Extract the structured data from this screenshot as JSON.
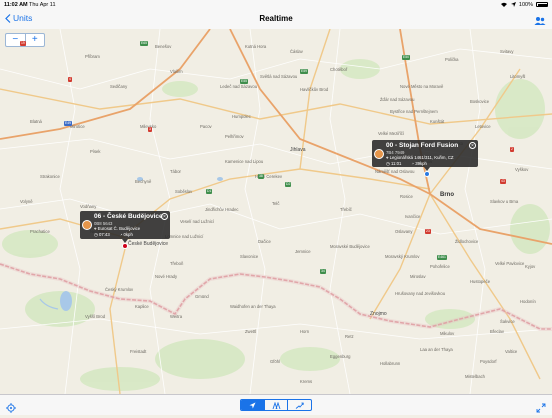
{
  "status": {
    "time": "11:02 AM",
    "date": "Thu Apr 11",
    "battery": "100%"
  },
  "nav": {
    "back_label": "Units",
    "title": "Realtime"
  },
  "map": {
    "zoom_in": "+",
    "zoom_out": "−",
    "places": {
      "brno": "Brno",
      "jihlava": "Jihlava",
      "budejovice": "České Budějovice",
      "znojmo": "Znojmo",
      "boskovice": "Boskovice",
      "blansko": "Blansko",
      "trebic": "Třebíč",
      "tabor": "Tábor",
      "pisek": "Písek",
      "pribram": "Příbram",
      "humpolec": "Humpolec",
      "havlickuv_brod": "Havlíčkův Brod",
      "zdar": "Žďár nad Sázavou",
      "velke_mezirici": "Velké Meziříčí",
      "telc": "Telč",
      "dacice": "Dačice",
      "jindrichuv_hradec": "Jindřichův Hradec",
      "trebon": "Třeboň",
      "cesky_krumlov": "Český Krumlov",
      "svitavy": "Svitavy",
      "policka": "Polička",
      "vyskov": "Vyškov",
      "hodonin": "Hodonín",
      "breclav": "Břeclav",
      "mikulov": "Mikulov",
      "hollabrunn": "Hollabrunn",
      "horn": "Horn",
      "zwettl": "Zwettl",
      "gmund": "Gmünd",
      "strakonice": "Strakonice",
      "prachatice": "Prachatice",
      "kamenice": "Kamenice nad Lipou",
      "pelhrimov": "Pelhřimov",
      "chotebor": "Chotěboř",
      "vlasim": "Vlašim",
      "benesov": "Benešov",
      "sedlcany": "Sedlčany",
      "milevsko": "Milevsko",
      "sobeslav": "Soběslav",
      "moravske_budejovice": "Moravské Budějovice",
      "ivancice": "Ivančice",
      "slavkov": "Slavkov u Brna",
      "kyjov": "Kyjov",
      "mistelbach": "Mistelbach",
      "laa": "Laa an der Thaya",
      "retz": "Retz",
      "waidhofen": "Waidhofen an der Thaya",
      "litomysl": "Litomyšl",
      "nove_mesto": "Nové Město na Moravě",
      "tisnov": "Tišnov",
      "kutna_hora": "Kutná Hora",
      "caslav": "Čáslav",
      "vodnany": "Vodňany",
      "volyne": "Volyně",
      "kaplice": "Kaplice",
      "horepnik": "Horní Cerekev",
      "pacov": "Pacov",
      "svetla": "Světlá nad Sázavou",
      "ledec": "Ledeč nad Sázavou",
      "bystrice": "Bystřice nad Pernštejnem",
      "kunstat": "Kunštát",
      "letovice": "Letovice",
      "rosice": "Rosice",
      "hrusovany": "Hrušovany nad Jevišovkou",
      "pohorelice": "Pohořelice",
      "zidlochovice": "Židlochovice",
      "hustopece": "Hustopeče",
      "velke_pavlovice": "Velké Pavlovice",
      "valtice": "Valtice",
      "poysdorf": "Poysdorf",
      "eggenburg": "Eggenburg",
      "gfohl": "Gföhl",
      "krems": "Krems",
      "weitra": "Weitra",
      "freistadt": "Freistadt",
      "vyssi_brod": "Vyšší Brod",
      "netolice": "Netolice",
      "blatna": "Blatná",
      "mirotice": "Mirotice",
      "bechyne": "Bechyně",
      "veseli": "Veselí nad Lužnicí",
      "lomnice": "Lomnice nad Lužnicí",
      "novesedlo": "Nové Hrady",
      "slavonice": "Slavonice",
      "jemnice": "Jemnice",
      "namest": "Náměšť nad Oslavou",
      "oslavany": "Oslavany",
      "moravsky_krumlov": "Moravský Krumlov",
      "miroslav": "Miroslav",
      "sekule": "Šakvice"
    },
    "roads": [
      "E50",
      "E59",
      "E55",
      "D1",
      "D2",
      "E65",
      "E461",
      "3",
      "4",
      "34",
      "38",
      "23",
      "E49",
      "2",
      "19",
      "43"
    ]
  },
  "popups": [
    {
      "title": "06 - České Budějovice",
      "plate": "0B8 5643",
      "address": "Eurosat Č. Budějovice",
      "time": "07:43",
      "speed": "0kph"
    },
    {
      "title": "00 - Stojan Ford Fusion",
      "plate": "7B4 7949",
      "address": "Legionářská 1461/311, Kuřim, CZ",
      "time": "11:01",
      "speed": "39kph"
    }
  ],
  "colors": {
    "accent": "#1a73e8",
    "map_bg": "#f1eee4",
    "border": "#d98a8f",
    "motorway": "#e9a36a",
    "main_road": "#f0c98a",
    "forest": "#cfe4b8",
    "water": "#a8c8e8",
    "popup_bg": "#282828",
    "marker_red": "#d0021b",
    "marker_blue": "#2a7ae2"
  },
  "icons": {
    "back": "chevron-left-icon",
    "users": "users-icon",
    "locate": "locate-icon",
    "expand": "expand-icon",
    "seg1": "navigation-icon",
    "seg2": "group-icon",
    "seg3": "route-icon"
  }
}
